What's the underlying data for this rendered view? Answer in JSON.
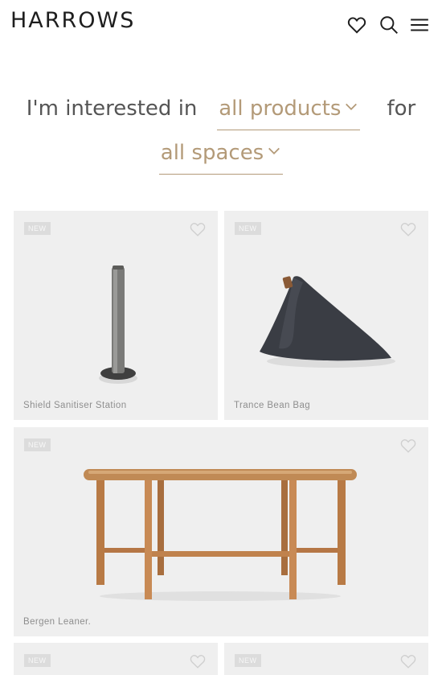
{
  "header": {
    "logo": "HARROWS",
    "icons": [
      "heart-icon",
      "search-icon",
      "menu-icon"
    ]
  },
  "filter": {
    "prefix": "I'm interested in",
    "product_select": "all products",
    "joiner": "for",
    "space_select": "all spaces"
  },
  "products": [
    {
      "badge": "NEW",
      "name": "Shield Sanitiser Station"
    },
    {
      "badge": "NEW",
      "name": "Trance Bean Bag"
    },
    {
      "badge": "NEW",
      "name": "Bergen Leaner."
    },
    {
      "badge": "NEW",
      "name": ""
    },
    {
      "badge": "NEW",
      "name": ""
    }
  ],
  "colors": {
    "accent": "#b39a78",
    "card_bg": "#efefef",
    "text_muted": "#8e8e8e"
  }
}
